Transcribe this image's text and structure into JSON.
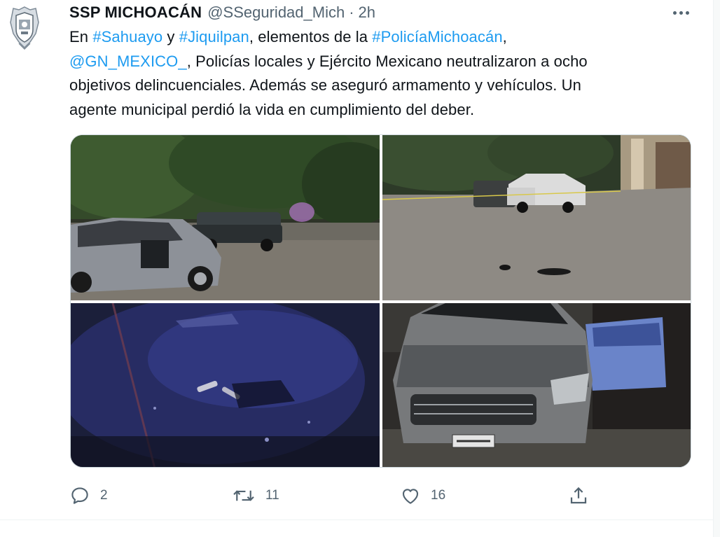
{
  "author": {
    "display_name": "SSP MICHOACÁN",
    "handle": "@SSeguridad_Mich",
    "separator": "·",
    "time": "2h"
  },
  "tweet": {
    "line1": {
      "t1": "En ",
      "l1": "#Sahuayo",
      "t2": " y ",
      "l2": "#Jiquilpan",
      "t3": ", elementos de la ",
      "l3": "#PolicíaMichoacán",
      "t4": ","
    },
    "line2": {
      "l1": "@GN_MEXICO_",
      "t1": ", Policías locales y Ejército Mexicano neutralizaron a ocho"
    },
    "line3": "objetivos delincuenciales. Además se aseguró armamento y vehículos. Un",
    "line4": "agente municipal perdió la vida en cumplimiento del deber."
  },
  "actions": {
    "replies": "2",
    "retweets": "11",
    "likes": "16"
  },
  "colors": {
    "link": "#1d9bf0",
    "secondary_text": "#536471",
    "primary_text": "#0f1419"
  },
  "icons": {
    "avatar": "police-shield-badge",
    "more": "more-horizontal-icon",
    "reply": "reply-icon",
    "retweet": "retweet-icon",
    "like": "heart-icon",
    "share": "share-icon"
  }
}
